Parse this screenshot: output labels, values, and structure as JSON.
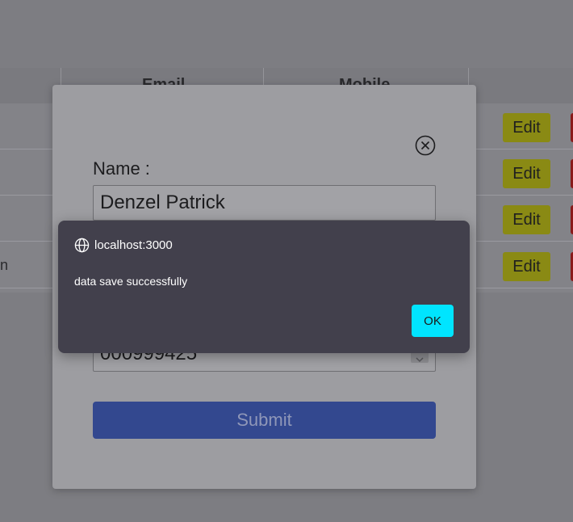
{
  "table": {
    "headers": {
      "email": "Email",
      "mobile": "Mobile"
    },
    "rows": [
      {
        "partial_text": ""
      },
      {
        "partial_text": ""
      },
      {
        "partial_text": ""
      },
      {
        "partial_text": "n"
      }
    ],
    "edit_label": "Edit"
  },
  "form": {
    "name_label": "Name :",
    "name_value": "Denzel Patrick",
    "mobile_value": "000999425",
    "submit_label": "Submit",
    "close_icon": "close-circle-icon"
  },
  "alert": {
    "origin": "localhost:3000",
    "message": "data save successfully",
    "ok_label": "OK",
    "origin_icon": "globe-icon"
  },
  "colors": {
    "alert_bg": "#42404c",
    "ok_button": "#00e5ff",
    "submit_button": "#33488f",
    "edit_button": "#8a8a14",
    "delete_button": "#8a1a1a"
  }
}
